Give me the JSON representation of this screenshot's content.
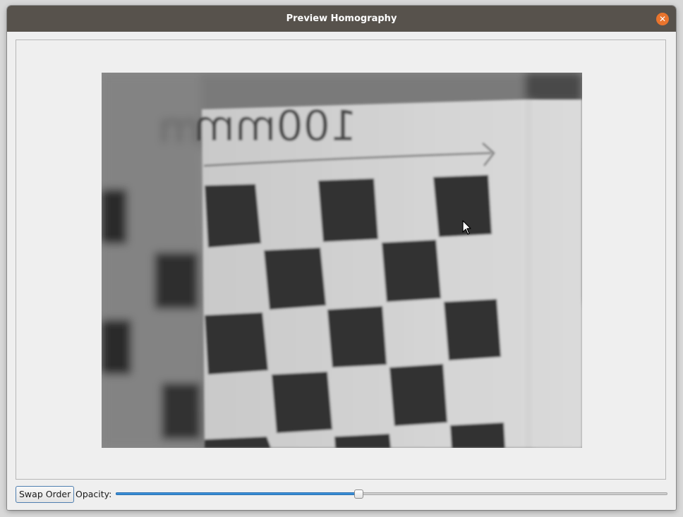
{
  "window": {
    "title": "Preview Homography",
    "close_icon": "close-icon",
    "titlebar_color": "#57524c",
    "close_color": "#e9742d"
  },
  "preview": {
    "overlay_text": "100mm",
    "images": [
      "background-image",
      "warped-image"
    ]
  },
  "controls": {
    "swap_label": "Swap Order",
    "opacity_label": "Opacity:",
    "opacity_value": 0.44,
    "accent_color": "#3a8fd8"
  }
}
